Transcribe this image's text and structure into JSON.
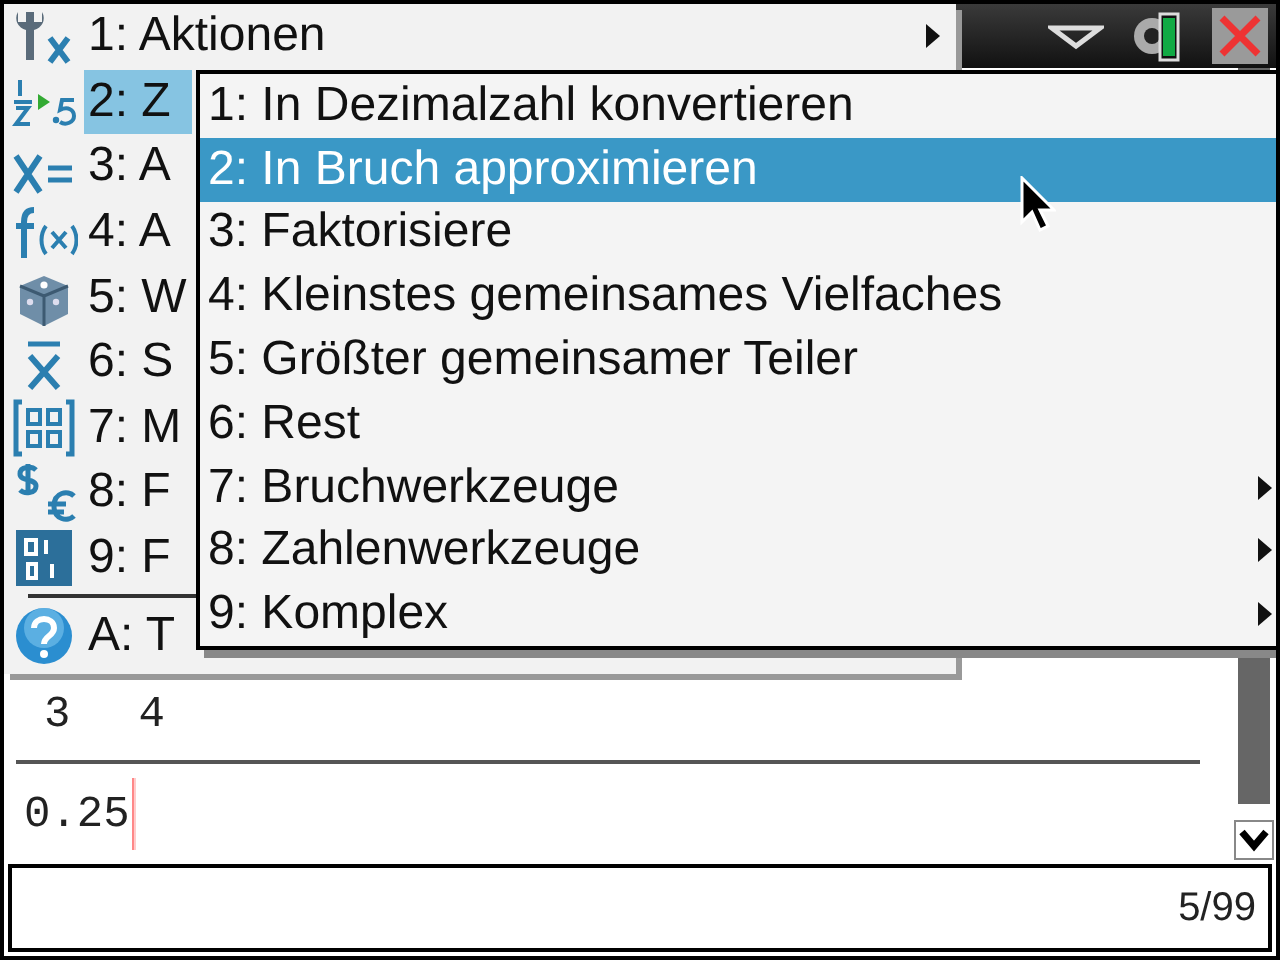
{
  "main_menu": {
    "items": [
      {
        "label": "1: Aktionen",
        "has_submenu": true,
        "selected": false
      },
      {
        "label": "2: Z",
        "has_submenu": false,
        "selected": true
      },
      {
        "label": "3: A",
        "has_submenu": false,
        "selected": false
      },
      {
        "label": "4: A",
        "has_submenu": false,
        "selected": false
      },
      {
        "label": "5: W",
        "has_submenu": false,
        "selected": false
      },
      {
        "label": "6: S",
        "has_submenu": false,
        "selected": false
      },
      {
        "label": "7: M",
        "has_submenu": false,
        "selected": false
      },
      {
        "label": "8: F",
        "has_submenu": false,
        "selected": false
      },
      {
        "label": "9: F",
        "has_submenu": false,
        "selected": false
      }
    ],
    "footer_item": {
      "label": "A: T"
    }
  },
  "submenu": {
    "items": [
      {
        "label": "1: In Dezimalzahl konvertieren",
        "has_submenu": false,
        "selected": false
      },
      {
        "label": "2: In Bruch approximieren",
        "has_submenu": false,
        "selected": true
      },
      {
        "label": "3: Faktorisiere",
        "has_submenu": false,
        "selected": false
      },
      {
        "label": "4: Kleinstes gemeinsames Vielfaches",
        "has_submenu": false,
        "selected": false
      },
      {
        "label": "5: Größter gemeinsamer Teiler",
        "has_submenu": false,
        "selected": false
      },
      {
        "label": "6: Rest",
        "has_submenu": false,
        "selected": false
      },
      {
        "label": "7: Bruchwerkzeuge",
        "has_submenu": true,
        "selected": false
      },
      {
        "label": "8: Zahlenwerkzeuge",
        "has_submenu": true,
        "selected": false
      },
      {
        "label": "9: Komplex",
        "has_submenu": true,
        "selected": false
      }
    ]
  },
  "history_row": [
    "3",
    "4"
  ],
  "entry": {
    "value": "0.25"
  },
  "status_bar": {
    "text": "5/99"
  }
}
